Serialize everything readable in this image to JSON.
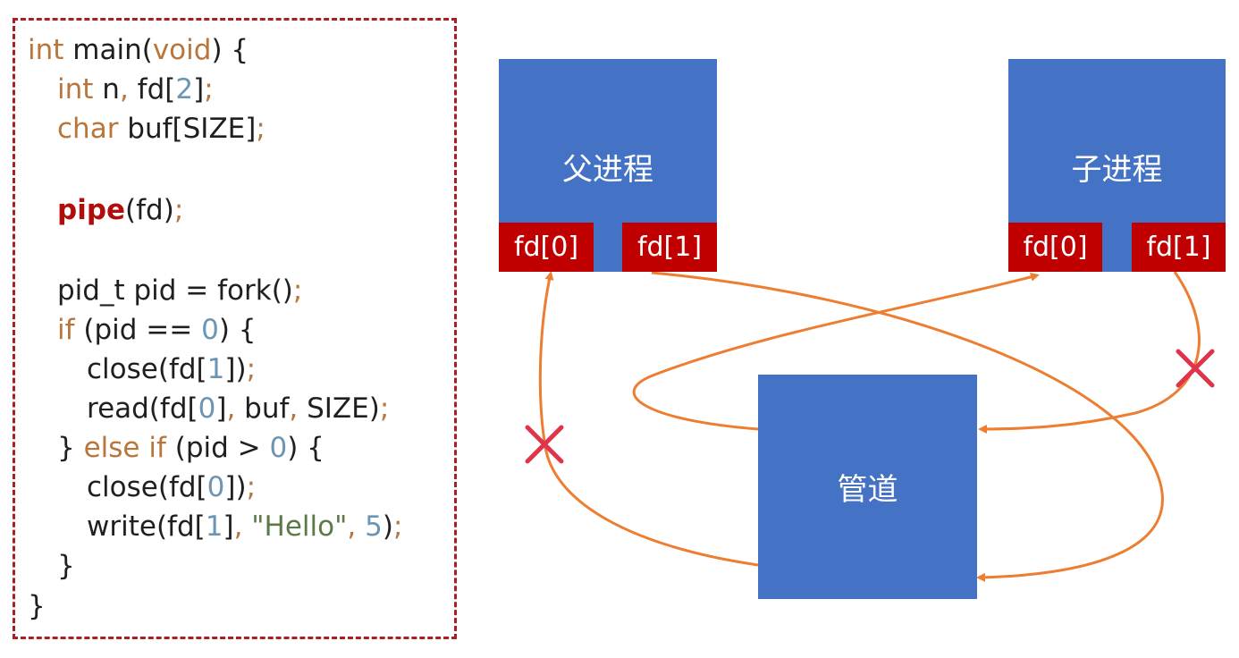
{
  "code": {
    "lines": [
      [
        {
          "t": "int",
          "c": "kw"
        },
        {
          "t": " main(",
          "c": "p"
        },
        {
          "t": "void",
          "c": "kw"
        },
        {
          "t": ") {",
          "c": "p"
        }
      ],
      [
        {
          "t": "int",
          "c": "kw"
        },
        {
          "t": " n",
          "c": "p"
        },
        {
          "t": ",",
          "c": "kw"
        },
        {
          "t": " fd[",
          "c": "p"
        },
        {
          "t": "2",
          "c": "num"
        },
        {
          "t": "]",
          "c": "p"
        },
        {
          "t": ";",
          "c": "kw"
        }
      ],
      [
        {
          "t": "char",
          "c": "kw"
        },
        {
          "t": " buf[SIZE]",
          "c": "p"
        },
        {
          "t": ";",
          "c": "kw"
        }
      ],
      [],
      [
        {
          "t": "pipe",
          "c": "pipe"
        },
        {
          "t": "(fd)",
          "c": "p"
        },
        {
          "t": ";",
          "c": "kw"
        }
      ],
      [],
      [
        {
          "t": "pid_t pid = fork()",
          "c": "p"
        },
        {
          "t": ";",
          "c": "kw"
        }
      ],
      [
        {
          "t": "if",
          "c": "kw"
        },
        {
          "t": " (pid == ",
          "c": "p"
        },
        {
          "t": "0",
          "c": "num"
        },
        {
          "t": ") {",
          "c": "p"
        }
      ],
      [
        {
          "t": "close(fd[",
          "c": "p"
        },
        {
          "t": "1",
          "c": "num"
        },
        {
          "t": "])",
          "c": "p"
        },
        {
          "t": ";",
          "c": "kw"
        }
      ],
      [
        {
          "t": "read(fd[",
          "c": "p"
        },
        {
          "t": "0",
          "c": "num"
        },
        {
          "t": "]",
          "c": "p"
        },
        {
          "t": ",",
          "c": "kw"
        },
        {
          "t": " buf",
          "c": "p"
        },
        {
          "t": ",",
          "c": "kw"
        },
        {
          "t": " SIZE)",
          "c": "p"
        },
        {
          "t": ";",
          "c": "kw"
        }
      ],
      [
        {
          "t": "} ",
          "c": "p"
        },
        {
          "t": "else if",
          "c": "kw"
        },
        {
          "t": " (pid > ",
          "c": "p"
        },
        {
          "t": "0",
          "c": "num"
        },
        {
          "t": ") {",
          "c": "p"
        }
      ],
      [
        {
          "t": "close(fd[",
          "c": "p"
        },
        {
          "t": "0",
          "c": "num"
        },
        {
          "t": "])",
          "c": "p"
        },
        {
          "t": ";",
          "c": "kw"
        }
      ],
      [
        {
          "t": "write(fd[",
          "c": "p"
        },
        {
          "t": "1",
          "c": "num"
        },
        {
          "t": "]",
          "c": "p"
        },
        {
          "t": ",",
          "c": "kw"
        },
        {
          "t": " \"Hello\"",
          "c": "str"
        },
        {
          "t": ",",
          "c": "kw"
        },
        {
          "t": " ",
          "c": "p"
        },
        {
          "t": "5",
          "c": "num"
        },
        {
          "t": ")",
          "c": "p"
        },
        {
          "t": ";",
          "c": "kw"
        }
      ],
      [
        {
          "t": "}",
          "c": "p"
        }
      ],
      [
        {
          "t": "}",
          "c": "p"
        }
      ]
    ]
  },
  "diagram": {
    "parent": {
      "label": "父进程",
      "fd0": "fd[0]",
      "fd1": "fd[1]"
    },
    "child": {
      "label": "子进程",
      "fd0": "fd[0]",
      "fd1": "fd[1]"
    },
    "pipe": {
      "label": "管道"
    },
    "colors": {
      "process": "#4472c4",
      "fd": "#c00000",
      "arrow": "#ed7d31",
      "cross": "#e0344b"
    }
  }
}
